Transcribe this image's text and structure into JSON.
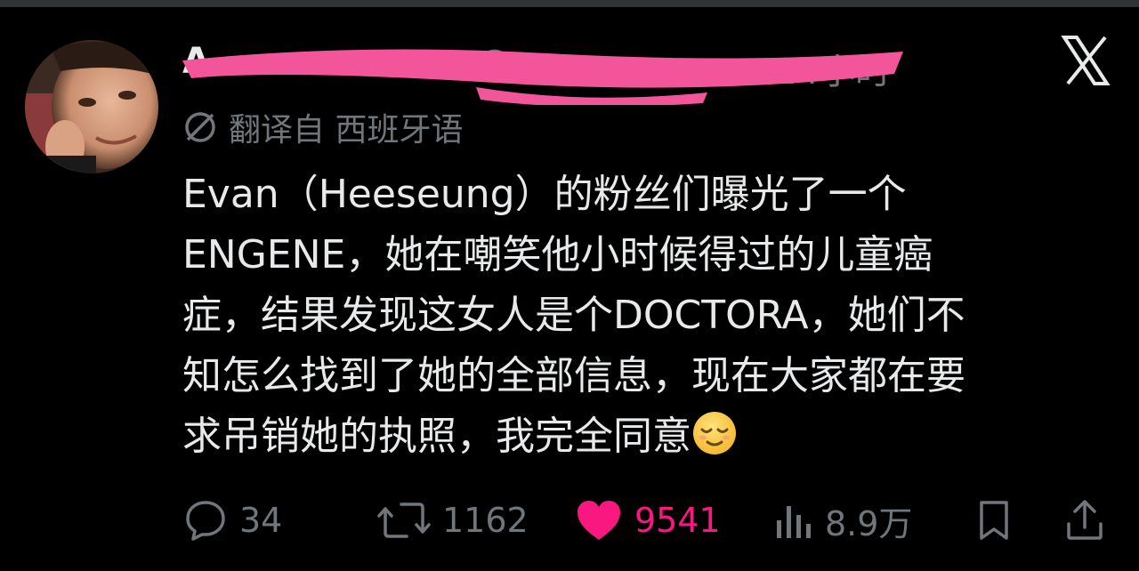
{
  "post": {
    "author_name": "A",
    "author_handle": "@",
    "timestamp": "14小时",
    "translation_note": "翻译自 西班牙语",
    "text_lines": [
      "Evan（Heeseung）的粉丝们曝光了一个",
      "ENGENE，她在嘲笑他小时候得过的儿童癌",
      "症，结果发现这女人是个DOCTORA，她们不",
      "知怎么找到了她的全部信息，现在大家都在要",
      "求吊销她的执照，我完全同意"
    ],
    "emoji": "relieved-face"
  },
  "actions": {
    "replies": "34",
    "reposts": "1162",
    "likes": "9541",
    "views": "8.9万"
  },
  "icons": {
    "close": "x-logo-icon",
    "reply": "reply-bubble-icon",
    "repost": "repost-icon",
    "like": "heart-icon",
    "views": "views-bar-icon",
    "bookmark": "bookmark-icon",
    "share": "share-icon",
    "translate": "globe-icon"
  },
  "colors": {
    "background": "#000000",
    "text": "#e7e9ea",
    "muted": "#71767b",
    "like_accent": "#f91880",
    "redaction": "#f2559a"
  }
}
